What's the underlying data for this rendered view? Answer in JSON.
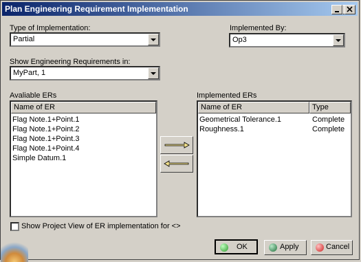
{
  "window": {
    "title": "Plan Engineering Requirement Implementation"
  },
  "type_of_implementation": {
    "label": "Type of Implementation:",
    "value": "Partial"
  },
  "implemented_by": {
    "label": "Implemented By:",
    "value": "Op3"
  },
  "show_in": {
    "label": "Show Engineering Requirements in:",
    "value": "MyPart, 1"
  },
  "available": {
    "label": "Avaliable ERs",
    "header": "Name of ER",
    "items": [
      "Flag Note.1+Point.1",
      "Flag Note.1+Point.2",
      "Flag Note.1+Point.3",
      "Flag Note.1+Point.4",
      "Simple Datum.1"
    ]
  },
  "implemented": {
    "label": "Implemented ERs",
    "headers": [
      "Name of ER",
      "Type"
    ],
    "rows": [
      {
        "name": "Geometrical Tolerance.1",
        "type": "Complete"
      },
      {
        "name": "Roughness.1",
        "type": "Complete"
      }
    ]
  },
  "checkbox": {
    "label": "Show Project View of ER implementation for <>"
  },
  "buttons": {
    "ok": "OK",
    "apply": "Apply",
    "cancel": "Cancel"
  },
  "colors": {
    "ok": "#2e9a2e",
    "apply": "#1f6e3a",
    "cancel": "#cc2222"
  }
}
